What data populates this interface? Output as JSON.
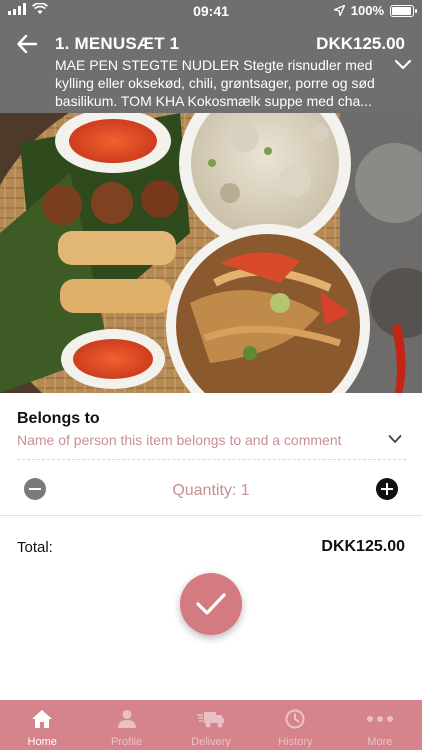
{
  "status_bar": {
    "time": "09:41",
    "battery_text": "100%",
    "battery_level": 1.0
  },
  "header": {
    "title": "1. MENUSÆT 1",
    "price": "DKK125.00",
    "description": "MAE PEN STEGTE NUDLER Stegte risnudler med kylling eller oksekød, chili, grøntsager, porre og sød basilikum. TOM KHA Kokosmælk suppe med cha...",
    "back_icon": "back-arrow-icon",
    "expand_icon": "chevron-down-icon"
  },
  "belongs_to": {
    "label": "Belongs to",
    "placeholder": "Name of person this item belongs to and a comment"
  },
  "quantity": {
    "text": "Quantity: 1",
    "value": 1
  },
  "total": {
    "label": "Total:",
    "value": "DKK125.00"
  },
  "confirm": {
    "icon": "checkmark-icon"
  },
  "tabbar": {
    "tabs": [
      {
        "label": "Home",
        "icon": "home-icon",
        "active": true
      },
      {
        "label": "Profile",
        "icon": "profile-icon",
        "active": false
      },
      {
        "label": "Delivery",
        "icon": "delivery-truck-icon",
        "active": false
      },
      {
        "label": "History",
        "icon": "history-clock-icon",
        "active": false
      },
      {
        "label": "More",
        "icon": "more-dots-icon",
        "active": false
      }
    ]
  },
  "colors": {
    "header_bg": "#6f6f6f",
    "accent": "#d4848a",
    "accent_text": "#c98f94",
    "confirm_bg": "#d47b82"
  }
}
